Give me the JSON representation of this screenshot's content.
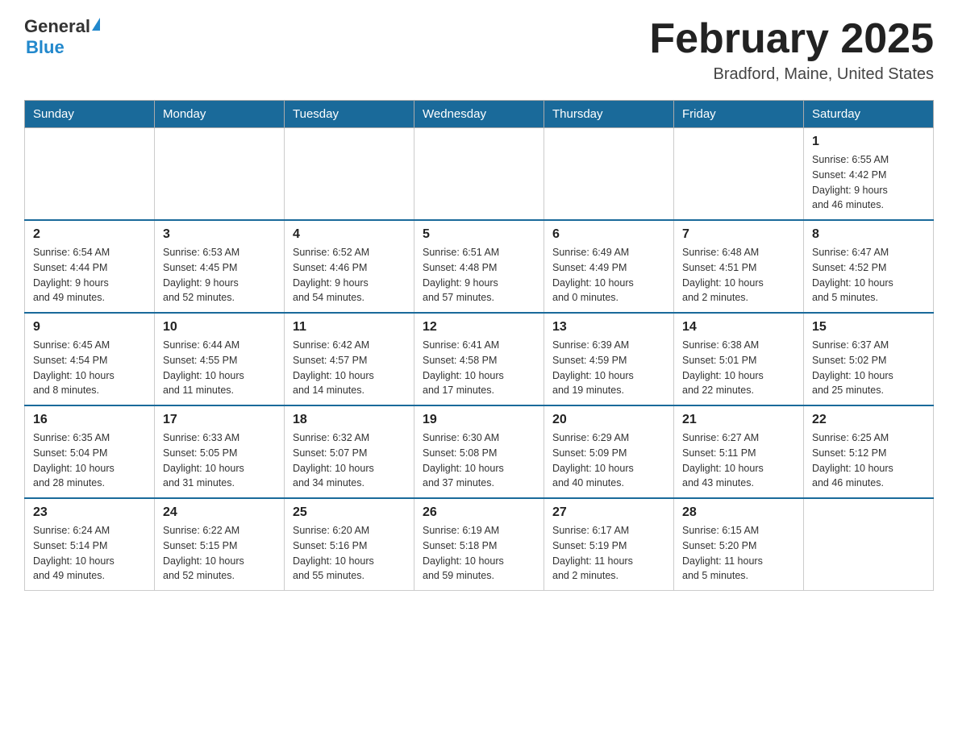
{
  "header": {
    "logo_general": "General",
    "logo_blue": "Blue",
    "month_title": "February 2025",
    "location": "Bradford, Maine, United States"
  },
  "weekdays": [
    "Sunday",
    "Monday",
    "Tuesday",
    "Wednesday",
    "Thursday",
    "Friday",
    "Saturday"
  ],
  "weeks": [
    [
      {
        "day": "",
        "info": ""
      },
      {
        "day": "",
        "info": ""
      },
      {
        "day": "",
        "info": ""
      },
      {
        "day": "",
        "info": ""
      },
      {
        "day": "",
        "info": ""
      },
      {
        "day": "",
        "info": ""
      },
      {
        "day": "1",
        "info": "Sunrise: 6:55 AM\nSunset: 4:42 PM\nDaylight: 9 hours\nand 46 minutes."
      }
    ],
    [
      {
        "day": "2",
        "info": "Sunrise: 6:54 AM\nSunset: 4:44 PM\nDaylight: 9 hours\nand 49 minutes."
      },
      {
        "day": "3",
        "info": "Sunrise: 6:53 AM\nSunset: 4:45 PM\nDaylight: 9 hours\nand 52 minutes."
      },
      {
        "day": "4",
        "info": "Sunrise: 6:52 AM\nSunset: 4:46 PM\nDaylight: 9 hours\nand 54 minutes."
      },
      {
        "day": "5",
        "info": "Sunrise: 6:51 AM\nSunset: 4:48 PM\nDaylight: 9 hours\nand 57 minutes."
      },
      {
        "day": "6",
        "info": "Sunrise: 6:49 AM\nSunset: 4:49 PM\nDaylight: 10 hours\nand 0 minutes."
      },
      {
        "day": "7",
        "info": "Sunrise: 6:48 AM\nSunset: 4:51 PM\nDaylight: 10 hours\nand 2 minutes."
      },
      {
        "day": "8",
        "info": "Sunrise: 6:47 AM\nSunset: 4:52 PM\nDaylight: 10 hours\nand 5 minutes."
      }
    ],
    [
      {
        "day": "9",
        "info": "Sunrise: 6:45 AM\nSunset: 4:54 PM\nDaylight: 10 hours\nand 8 minutes."
      },
      {
        "day": "10",
        "info": "Sunrise: 6:44 AM\nSunset: 4:55 PM\nDaylight: 10 hours\nand 11 minutes."
      },
      {
        "day": "11",
        "info": "Sunrise: 6:42 AM\nSunset: 4:57 PM\nDaylight: 10 hours\nand 14 minutes."
      },
      {
        "day": "12",
        "info": "Sunrise: 6:41 AM\nSunset: 4:58 PM\nDaylight: 10 hours\nand 17 minutes."
      },
      {
        "day": "13",
        "info": "Sunrise: 6:39 AM\nSunset: 4:59 PM\nDaylight: 10 hours\nand 19 minutes."
      },
      {
        "day": "14",
        "info": "Sunrise: 6:38 AM\nSunset: 5:01 PM\nDaylight: 10 hours\nand 22 minutes."
      },
      {
        "day": "15",
        "info": "Sunrise: 6:37 AM\nSunset: 5:02 PM\nDaylight: 10 hours\nand 25 minutes."
      }
    ],
    [
      {
        "day": "16",
        "info": "Sunrise: 6:35 AM\nSunset: 5:04 PM\nDaylight: 10 hours\nand 28 minutes."
      },
      {
        "day": "17",
        "info": "Sunrise: 6:33 AM\nSunset: 5:05 PM\nDaylight: 10 hours\nand 31 minutes."
      },
      {
        "day": "18",
        "info": "Sunrise: 6:32 AM\nSunset: 5:07 PM\nDaylight: 10 hours\nand 34 minutes."
      },
      {
        "day": "19",
        "info": "Sunrise: 6:30 AM\nSunset: 5:08 PM\nDaylight: 10 hours\nand 37 minutes."
      },
      {
        "day": "20",
        "info": "Sunrise: 6:29 AM\nSunset: 5:09 PM\nDaylight: 10 hours\nand 40 minutes."
      },
      {
        "day": "21",
        "info": "Sunrise: 6:27 AM\nSunset: 5:11 PM\nDaylight: 10 hours\nand 43 minutes."
      },
      {
        "day": "22",
        "info": "Sunrise: 6:25 AM\nSunset: 5:12 PM\nDaylight: 10 hours\nand 46 minutes."
      }
    ],
    [
      {
        "day": "23",
        "info": "Sunrise: 6:24 AM\nSunset: 5:14 PM\nDaylight: 10 hours\nand 49 minutes."
      },
      {
        "day": "24",
        "info": "Sunrise: 6:22 AM\nSunset: 5:15 PM\nDaylight: 10 hours\nand 52 minutes."
      },
      {
        "day": "25",
        "info": "Sunrise: 6:20 AM\nSunset: 5:16 PM\nDaylight: 10 hours\nand 55 minutes."
      },
      {
        "day": "26",
        "info": "Sunrise: 6:19 AM\nSunset: 5:18 PM\nDaylight: 10 hours\nand 59 minutes."
      },
      {
        "day": "27",
        "info": "Sunrise: 6:17 AM\nSunset: 5:19 PM\nDaylight: 11 hours\nand 2 minutes."
      },
      {
        "day": "28",
        "info": "Sunrise: 6:15 AM\nSunset: 5:20 PM\nDaylight: 11 hours\nand 5 minutes."
      },
      {
        "day": "",
        "info": ""
      }
    ]
  ]
}
